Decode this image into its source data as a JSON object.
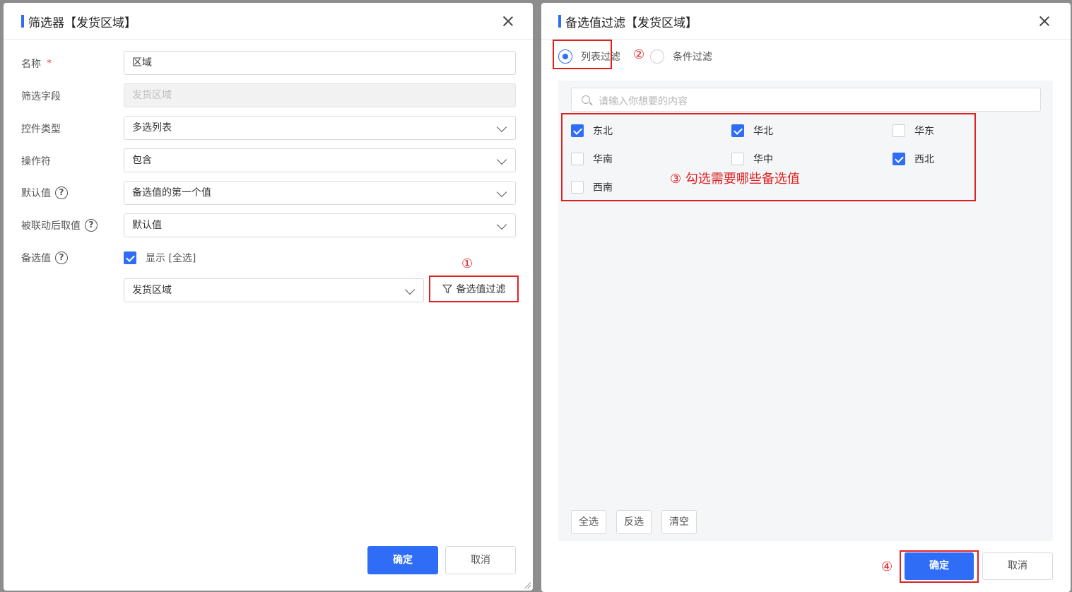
{
  "left_dialog": {
    "title": "筛选器【发货区域】",
    "fields": {
      "name": {
        "label": "名称",
        "required_mark": "*",
        "value": "区域"
      },
      "filter_field": {
        "label": "筛选字段",
        "value": "发货区域"
      },
      "control_type": {
        "label": "控件类型",
        "value": "多选列表"
      },
      "operator": {
        "label": "操作符",
        "value": "包含"
      },
      "default_value": {
        "label": "默认值",
        "value": "备选值的第一个值"
      },
      "linked_value": {
        "label": "被联动后取值",
        "value": "默认值"
      },
      "options": {
        "label": "备选值",
        "show_all_label": "显示 [全选]",
        "show_all_checked": true,
        "source_value": "发货区域"
      }
    },
    "help_icon": "?",
    "filter_button_label": "备选值过滤",
    "marker_1": "①",
    "confirm_label": "确定",
    "cancel_label": "取消"
  },
  "right_dialog": {
    "title": "备选值过滤【发货区域】",
    "radio_options": [
      {
        "label": "列表过滤",
        "checked": true
      },
      {
        "label": "条件过滤",
        "checked": false
      }
    ],
    "marker_2": "②",
    "search_placeholder": "请输入你想要的内容",
    "options": [
      {
        "label": "东北",
        "checked": true
      },
      {
        "label": "华北",
        "checked": true
      },
      {
        "label": "华东",
        "checked": false
      },
      {
        "label": "华南",
        "checked": false
      },
      {
        "label": "华中",
        "checked": false
      },
      {
        "label": "西北",
        "checked": true
      },
      {
        "label": "西南",
        "checked": false
      }
    ],
    "annotation_3": "③ 勾选需要哪些备选值",
    "select_all_label": "全选",
    "invert_label": "反选",
    "clear_label": "清空",
    "marker_4": "④",
    "confirm_label": "确定",
    "cancel_label": "取消"
  },
  "colors": {
    "accent": "#2f6df6",
    "highlight": "#e02020"
  }
}
